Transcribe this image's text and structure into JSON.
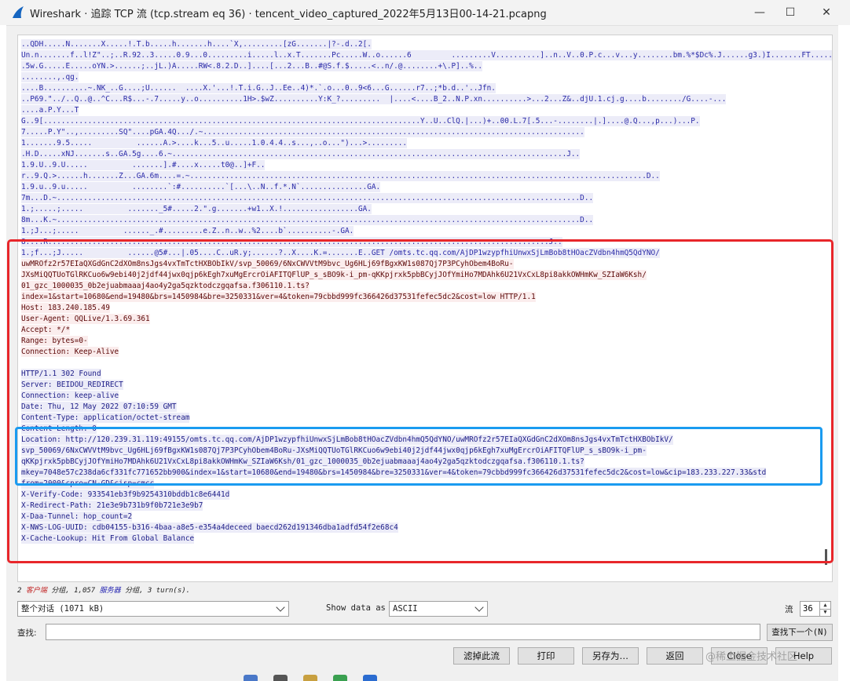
{
  "window": {
    "title": "Wireshark · 追踪 TCP 流 (tcp.stream eq 36) · tencent_video_captured_2022年5月13日00-14-21.pcapng",
    "minimize": "—",
    "maximize": "☐",
    "close": "✕"
  },
  "stream_lines": [
    {
      "t": "c",
      "text": "..QDH.....N.......X.....!.T.b.....h.......h....`X,.........[zG.......|?-.d..2[."
    },
    {
      "t": "c",
      "text": "Un.n.......f..l!Z\"..;..R.92..3.....0.9...0.........i.....l..x.T.......Pc.....W..o......6         .........V..........]..n..V..0.P.c...v...y........bm.%*$Dc%.J......g3.)I.......FT......"
    },
    {
      "t": "c",
      "text": ".5w.G.....E.....oYN.>......;..jL.)A.....RW<.8.2.D..]....[...2...B..#@S.f.$.....<..n/.@........+\\.P]..%.."
    },
    {
      "t": "c",
      "text": "........,.qg."
    },
    {
      "t": "c",
      "text": "....B..........~.NK_..G....;U......  ....X.'...!.T.i.G..J..Ee..4)*.`.o...0..9<6...G......r7..;*b.d..'..Jfn."
    },
    {
      "t": "c",
      "text": "..P69.\"../..Q..@..^C...R$...-.7.....y..o..........1H>.$wZ..........Y:K_?.........  |....<....B_2..N.P.xn..........>...2...Z&..djU.1.cj.g....b......../G....-..."
    },
    {
      "t": "c",
      "text": "....a.P.Y...T"
    },
    {
      "t": "c",
      "text": "G..9[.....................................................................................Y..U..ClQ.|...)+..00.L.7[.5...-........|.]....@.Q...,p...)...P."
    },
    {
      "t": "c",
      "text": "7.....P.Y\"..,.........SQ\"....pGA.4Q.../.~......................................................................................"
    },
    {
      "t": "c",
      "text": "1.......9.5.....          ......A.>....k...5..u.....1.0.4.4..s...,..o...\")...>........."
    },
    {
      "t": "c",
      "text": ".H.D.....xNJ.......s..GA.5g....6.~.........................................................................................J.."
    },
    {
      "t": "c",
      "text": "1.9.U..9.U.....          .......].#....x.....t0@..]+F.."
    },
    {
      "t": "c",
      "text": "r..9.Q.>......h.......Z...GA.6m....=.~.......................................................................................................D.."
    },
    {
      "t": "c",
      "text": "1.9.u..9.u.....          ........`:#..........`[...\\..N..f.*.N`...............GA."
    },
    {
      "t": "c",
      "text": "7m...D.~......................................................................................................................D.."
    },
    {
      "t": "c",
      "text": "1.;.....;.....          ......._5#.....2.\".g.......+w1..X.!.................GA."
    },
    {
      "t": "c",
      "text": "8m...K.~......................................................................................................................D.."
    },
    {
      "t": "c",
      "text": "1.;J...;.....          ......_.#.........e.Z..n..w..%2....b`..........-.GA."
    },
    {
      "t": "c",
      "text": "8....R.................................................................................................................J.."
    },
    {
      "t": "c",
      "text": "1.;f...;J.....          ......@5#...|.05....C..uR.y;......?..X....K.=.......E..GET /omts.tc.qq.com/AjDP1wzypfhiUnwxSjLmBob8tHOacZVdbn4hmQ5QdYNO/"
    },
    {
      "t": "d",
      "text": "uwMROfz2r57EIaQXGdGnC2dXOm8nsJgs4vxTmTctHXBObIkV/svp_50069/6NxCWVVtM9bvc_Ug6HLj69fBgxKW1s087Qj7P3PCyhObem4BoRu-"
    },
    {
      "t": "d",
      "text": "JXsMiQQTUoTGlRKCuo6w9ebi40j2jdf44jwx0qjp6kEgh7xuMgErcrOiAFITQFlUP_s_sBO9k-i_pm-qKKpjrxk5pbBCyjJOfYmiHo7MDAhk6U21VxCxL8pi8akkOWHmKw_SZIaW6Ksh/"
    },
    {
      "t": "d",
      "text": "01_gzc_1000035_0b2ejuabmaaaj4ao4y2ga5qzktodczgqafsa.f306110.1.ts?"
    },
    {
      "t": "d",
      "text": "index=1&start=10680&end=19480&brs=1450984&bre=3250331&ver=4&token=79cbbd999fc366426d37531fefec5dc2&cost=low HTTP/1.1"
    },
    {
      "t": "d",
      "text": "Host: 183.240.185.49"
    },
    {
      "t": "d",
      "text": "User-Agent: QQLive/1.3.69.361"
    },
    {
      "t": "d",
      "text": "Accept: */*"
    },
    {
      "t": "d",
      "text": "Range: bytes=0-"
    },
    {
      "t": "d",
      "text": "Connection: Keep-Alive"
    },
    {
      "t": "b",
      "text": ""
    },
    {
      "t": "s",
      "text": "HTTP/1.1 302 Found"
    },
    {
      "t": "s",
      "text": "Server: BEIDOU_REDIRECT"
    },
    {
      "t": "s",
      "text": "Connection: keep-alive"
    },
    {
      "t": "s",
      "text": "Date: Thu, 12 May 2022 07:10:59 GMT"
    },
    {
      "t": "s",
      "text": "Content-Type: application/octet-stream"
    },
    {
      "t": "s",
      "text": "Content-Length: 0"
    },
    {
      "t": "s",
      "text": "Location: http://120.239.31.119:49155/omts.tc.qq.com/AjDP1wzypfhiUnwxSjLmBob8tHOacZVdbn4hmQ5QdYNO/uwMROfz2r57EIaQXGdGnC2dXOm8nsJgs4vxTmTctHXBObIkV/"
    },
    {
      "t": "s",
      "text": "svp_50069/6NxCWVVtM9bvc_Ug6HLj69fBgxKW1s087Qj7P3PCyhObem4BoRu-JXsMiQQTUoTGlRKCuo6w9ebi40j2jdf44jwx0qjp6kEgh7xuMgErcrOiAFITQFlUP_s_sBO9k-i_pm-"
    },
    {
      "t": "s",
      "text": "qKKpjrxk5pbBCyjJOfYmiHo7MDAhk6U21VxCxL8pi8akkOWHmKw_SZIaW6Ksh/01_gzc_1000035_0b2ejuabmaaaj4ao4y2ga5qzktodczgqafsa.f306110.1.ts?"
    },
    {
      "t": "s",
      "text": "mkey=7048e57c238da6cf331fc771652bb900&index=1&start=10680&end=19480&brs=1450984&bre=3250331&ver=4&token=79cbbd999fc366426d37531fefec5dc2&cost=low&cip=183.233.227.33&std"
    },
    {
      "t": "s",
      "text": "from=2000&cpro=CN-GD&cisp=cmcc"
    },
    {
      "t": "s",
      "text": "X-Verify-Code: 933541eb3f9b9254310bddb1c8e6441d"
    },
    {
      "t": "s",
      "text": "X-Redirect-Path: 21e3e9b731b9f0b721e3e9b7"
    },
    {
      "t": "s",
      "text": "X-Daa-Tunnel: hop_count=2"
    },
    {
      "t": "s",
      "text": "X-NWS-LOG-UUID: cdb04155-b316-4baa-a8e5-e354a4deceed baecd262d191346dba1adfd54f2e68c4"
    },
    {
      "t": "s",
      "text": "X-Cache-Lookup: Hit From Global Balance"
    }
  ],
  "stats": {
    "prefix": "2 ",
    "client_label": "客户端",
    "mid1": " 分组, 1,057 ",
    "server_label": "服务器",
    "mid2": " 分组, 3 turn(s)."
  },
  "controls": {
    "conversation_select": "整个对话 (1071 kB)",
    "show_data_as_label": "Show data as",
    "show_data_as_value": "ASCII",
    "stream_label": "流",
    "stream_value": "36",
    "find_label": "查找:",
    "find_value": "",
    "find_next": "查找下一个(N)"
  },
  "buttons": {
    "filter_out": "滤掉此流",
    "print": "打印",
    "save_as": "另存为…",
    "back": "返回",
    "close": "Close",
    "help": "Help"
  },
  "watermark": "@稀土掘金技术社区",
  "colors": {
    "client_text": "#2a2aa8",
    "client_bg": "#ececf8",
    "server_text": "#5b0606",
    "server_bg": "#fbeded",
    "highlight_red": "#e8262a",
    "highlight_blue": "#1a9bf0"
  }
}
